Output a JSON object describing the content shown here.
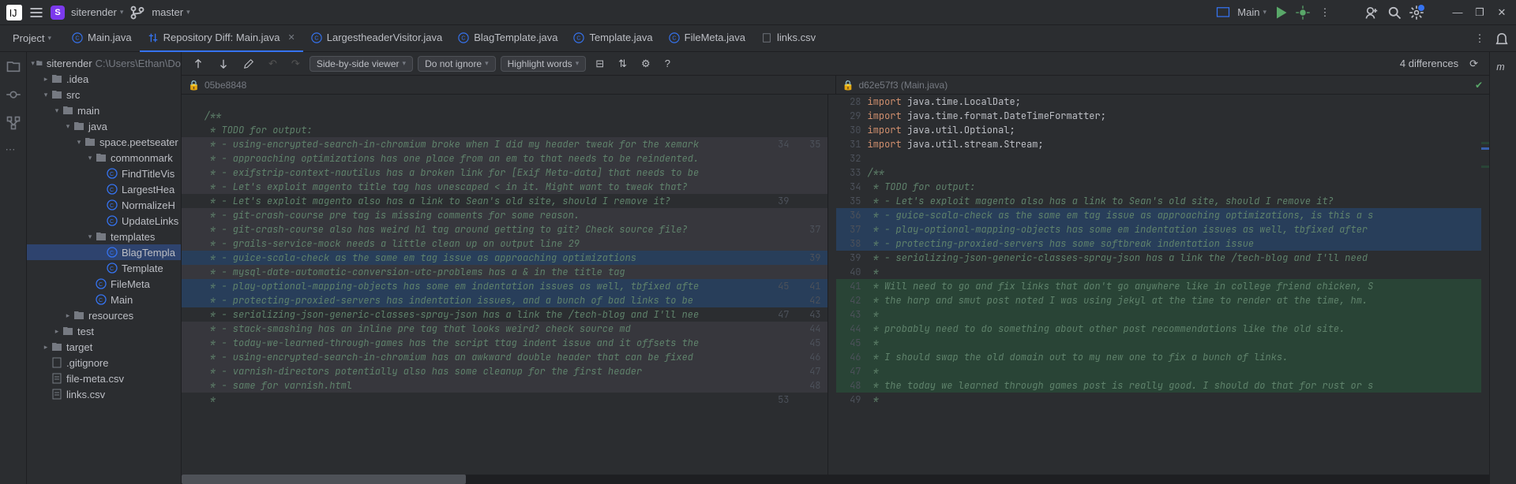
{
  "titlebar": {
    "project_initial": "S",
    "project_name": "siterender",
    "branch": "master",
    "run_config": "Main"
  },
  "project_label": "Project",
  "tabs": [
    {
      "label": "Main.java",
      "icon": "java",
      "active": false
    },
    {
      "label": "Repository Diff: Main.java",
      "icon": "diff",
      "active": true,
      "closable": true
    },
    {
      "label": "LargestheaderVisitor.java",
      "icon": "java"
    },
    {
      "label": "BlagTemplate.java",
      "icon": "java"
    },
    {
      "label": "Template.java",
      "icon": "java"
    },
    {
      "label": "FileMeta.java",
      "icon": "java"
    },
    {
      "label": "links.csv",
      "icon": "csv"
    }
  ],
  "tree": [
    {
      "depth": 0,
      "arrow": "▾",
      "icon": "folder",
      "label": "siterender",
      "suffix": "C:\\Users\\Ethan\\Do"
    },
    {
      "depth": 1,
      "arrow": "▸",
      "icon": "folder",
      "label": ".idea"
    },
    {
      "depth": 1,
      "arrow": "▾",
      "icon": "folder",
      "label": "src"
    },
    {
      "depth": 2,
      "arrow": "▾",
      "icon": "folder",
      "label": "main"
    },
    {
      "depth": 3,
      "arrow": "▾",
      "icon": "folder",
      "label": "java"
    },
    {
      "depth": 4,
      "arrow": "▾",
      "icon": "folder",
      "label": "space.peetseater"
    },
    {
      "depth": 5,
      "arrow": "▾",
      "icon": "folder",
      "label": "commonmark"
    },
    {
      "depth": 6,
      "arrow": "",
      "icon": "java",
      "label": "FindTitleVis"
    },
    {
      "depth": 6,
      "arrow": "",
      "icon": "java",
      "label": "LargestHea"
    },
    {
      "depth": 6,
      "arrow": "",
      "icon": "java",
      "label": "NormalizeH"
    },
    {
      "depth": 6,
      "arrow": "",
      "icon": "java",
      "label": "UpdateLinks"
    },
    {
      "depth": 5,
      "arrow": "▾",
      "icon": "folder",
      "label": "templates"
    },
    {
      "depth": 6,
      "arrow": "",
      "icon": "java",
      "label": "BlagTempla",
      "selected": true
    },
    {
      "depth": 6,
      "arrow": "",
      "icon": "java",
      "label": "Template"
    },
    {
      "depth": 5,
      "arrow": "",
      "icon": "java",
      "label": "FileMeta"
    },
    {
      "depth": 5,
      "arrow": "",
      "icon": "java",
      "label": "Main"
    },
    {
      "depth": 3,
      "arrow": "▸",
      "icon": "folder",
      "label": "resources"
    },
    {
      "depth": 2,
      "arrow": "▸",
      "icon": "folder",
      "label": "test"
    },
    {
      "depth": 1,
      "arrow": "▸",
      "icon": "folder",
      "label": "target"
    },
    {
      "depth": 1,
      "arrow": "",
      "icon": "file",
      "label": ".gitignore"
    },
    {
      "depth": 1,
      "arrow": "",
      "icon": "csv",
      "label": "file-meta.csv"
    },
    {
      "depth": 1,
      "arrow": "",
      "icon": "csv",
      "label": "links.csv"
    }
  ],
  "diff_toolbar": {
    "view_mode": "Side-by-side viewer",
    "ignore_mode": "Do not ignore",
    "highlight_mode": "Highlight words",
    "diff_count": "4 differences"
  },
  "file_headers": {
    "left": "05be8848",
    "right": "d62e57f3 (Main.java)"
  },
  "left_lines": [
    {
      "ln": "",
      "r": "",
      "text": "",
      "class": ""
    },
    {
      "ln": "",
      "r": "",
      "text": "/**",
      "class": "c-comment"
    },
    {
      "ln": "",
      "r": "",
      "text": " * TODO for output:",
      "class": "c-comment"
    },
    {
      "ln": "",
      "r": "34",
      "text": " * - using-encrypted-search-in-chromium broke when I did my header tweak for the xemark",
      "class": "c-comment",
      "bg": "bg-gray"
    },
    {
      "ln": "",
      "r": "",
      "text": " * - approaching optimizations has one place from an em to that needs to be reindented.",
      "class": "c-comment",
      "bg": "bg-gray"
    },
    {
      "ln": "",
      "r": "",
      "text": " * - exifstrip-context-nautilus has a broken link for [Exif Meta-data] that needs to be",
      "class": "c-comment",
      "bg": "bg-gray"
    },
    {
      "ln": "",
      "r": "",
      "text": " * - Let's exploit magento title tag has unescaped < in it. Might want to tweak that?",
      "class": "c-comment",
      "bg": "bg-gray"
    },
    {
      "ln": "",
      "r": "39",
      "text": " * - Let's exploit magento also has a link to Sean's old site, should I remove it?",
      "class": "c-comment"
    },
    {
      "ln": "",
      "r": "",
      "text": " * - git-crash-course pre tag is missing comments for some reason.",
      "class": "c-comment",
      "bg": "bg-gray"
    },
    {
      "ln": "",
      "r": "",
      "text": " * - git-crash-course also has weird h1 tag around getting to git? Check source file?",
      "class": "c-comment",
      "bg": "bg-gray"
    },
    {
      "ln": "",
      "r": "",
      "text": " * - grails-service-mock needs a little clean up on output line 29",
      "class": "c-comment",
      "bg": "bg-gray"
    },
    {
      "ln": "",
      "r": "",
      "text": " * - guice-scala-check as the same em tag issue as approaching optimizations",
      "class": "c-comment",
      "bg": "bg-blue"
    },
    {
      "ln": "",
      "r": "",
      "text": " * - mysql-date-automatic-conversion-utc-problems has a & in the title tag",
      "class": "c-comment",
      "bg": "bg-gray"
    },
    {
      "ln": "",
      "r": "45",
      "text": " * - play-optional-mapping-objects has some em indentation issues as well, tbfixed afte",
      "class": "c-comment",
      "bg": "bg-blue"
    },
    {
      "ln": "",
      "r": "",
      "text": " * - protecting-proxied-servers has indentation issues, and a bunch of bad links to be",
      "class": "c-comment",
      "bg": "bg-blue"
    },
    {
      "ln": "",
      "r": "47",
      "text": " * - serializing-json-generic-classes-spray-json has a link the /tech-blog and I'll nee",
      "class": "c-comment"
    },
    {
      "ln": "",
      "r": "",
      "text": " * - stack-smashing has an inline pre tag that looks weird? check source md",
      "class": "c-comment",
      "bg": "bg-gray"
    },
    {
      "ln": "",
      "r": "",
      "text": " * - today-we-learned-through-games has the script ttag indent issue and it offsets the",
      "class": "c-comment",
      "bg": "bg-gray"
    },
    {
      "ln": "",
      "r": "",
      "text": " * - using-encrypted-search-in-chromium has an awkward double header that can be fixed",
      "class": "c-comment",
      "bg": "bg-gray"
    },
    {
      "ln": "",
      "r": "",
      "text": " * - varnish-directors potentially also has some cleanup for the first header",
      "class": "c-comment",
      "bg": "bg-gray"
    },
    {
      "ln": "",
      "r": "",
      "text": " * - same for varnish.html",
      "class": "c-comment",
      "bg": "bg-gray"
    },
    {
      "ln": "",
      "r": "53",
      "text": " *",
      "class": "c-comment"
    }
  ],
  "right_lines": [
    {
      "ln": "28",
      "text": "import java.time.LocalDate;",
      "class": "c-str"
    },
    {
      "ln": "29",
      "text": "import java.time.format.DateTimeFormatter;",
      "class": "c-str"
    },
    {
      "ln": "30",
      "text": "import java.util.Optional;",
      "class": "c-str"
    },
    {
      "ln": "31",
      "text": "import java.util.stream.Stream;",
      "class": "c-str"
    },
    {
      "ln": "32",
      "text": "",
      "class": ""
    },
    {
      "ln": "33",
      "text": "/**",
      "class": "c-comment"
    },
    {
      "ln": "34",
      "text": " * TODO for output:",
      "class": "c-comment"
    },
    {
      "ln": "35",
      "text": " * - Let's exploit magento also has a link to Sean's old site, should I remove it?",
      "class": "c-comment"
    },
    {
      "ln": "36",
      "text": " * - guice-scala-check as the same em tag issue as approaching optimizations, is this a s",
      "class": "c-comment",
      "bg": "bg-blue"
    },
    {
      "ln": "37",
      "text": " * - play-optional-mapping-objects has some em indentation issues as well, tbfixed after",
      "class": "c-comment",
      "bg": "bg-blue"
    },
    {
      "ln": "38",
      "text": " * - protecting-proxied-servers has some softbreak indentation issue",
      "class": "c-comment",
      "bg": "bg-blue"
    },
    {
      "ln": "39",
      "text": " * - serializing-json-generic-classes-spray-json has a link the /tech-blog and I'll need",
      "class": "c-comment"
    },
    {
      "ln": "40",
      "text": " *",
      "class": "c-comment"
    },
    {
      "ln": "41",
      "text": " * Will need to go and fix links that don't go anywhere like in college friend chicken, S",
      "class": "c-comment",
      "bg": "bg-green"
    },
    {
      "ln": "42",
      "text": " * the harp and smut post noted I was using jekyl at the time to render at the time, hm.",
      "class": "c-comment",
      "bg": "bg-green"
    },
    {
      "ln": "43",
      "text": " *",
      "class": "c-comment",
      "bg": "bg-green"
    },
    {
      "ln": "44",
      "text": " * probably need to do something about other post recommendations like the old site.",
      "class": "c-comment",
      "bg": "bg-green"
    },
    {
      "ln": "45",
      "text": " *",
      "class": "c-comment",
      "bg": "bg-green"
    },
    {
      "ln": "46",
      "text": " * I should swap the old domain out to my new one to fix a bunch of links.",
      "class": "c-comment",
      "bg": "bg-green"
    },
    {
      "ln": "47",
      "text": " *",
      "class": "c-comment",
      "bg": "bg-green"
    },
    {
      "ln": "48",
      "text": " * the today we learned through games post is really good. I should do that for rust or s",
      "class": "c-comment",
      "bg": "bg-green"
    },
    {
      "ln": "49",
      "text": " *",
      "class": "c-comment"
    }
  ],
  "left_outer_gutter": [
    "",
    "",
    "",
    "35",
    "",
    "",
    "",
    "",
    "",
    "37",
    "",
    "39",
    "",
    "41",
    "42",
    "43",
    "44",
    "45",
    "46",
    "47",
    "48",
    ""
  ]
}
